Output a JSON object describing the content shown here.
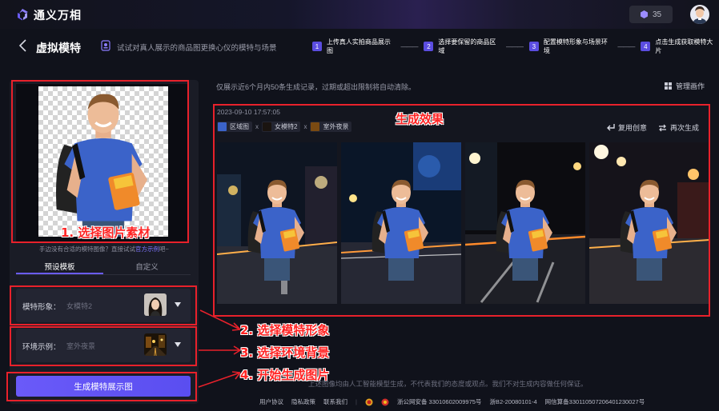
{
  "app": {
    "title": "通义万相",
    "points": "35"
  },
  "header": {
    "title": "虚拟模特",
    "subtitle": "试试对真人展示的商品图更换心仪的模特与场景",
    "steps": [
      {
        "num": "1",
        "label": "上传真人实拍商品展示图"
      },
      {
        "num": "2",
        "label": "选择要保留的商品区域"
      },
      {
        "num": "3",
        "label": "配置模特形象与场景环境"
      },
      {
        "num": "4",
        "label": "点击生成获取模特大片"
      }
    ],
    "step_separator": "———"
  },
  "left": {
    "hint_prefix": "手边没有合适的模特图像？直接试试",
    "hint_link": "官方示例",
    "hint_suffix": "吧~",
    "tabs": [
      "预设模板",
      "自定义"
    ],
    "model": {
      "label": "模特形象：",
      "value": "女模特2"
    },
    "scene": {
      "label": "环境示例：",
      "value": "室外夜景"
    },
    "generate_button": "生成模特展示图"
  },
  "main": {
    "notice": "仅展示近6个月内50条生成记录，过期或超出限制将自动清除。",
    "manage_label": "管理画作",
    "record": {
      "timestamp": "2023-09-10 17:57:05",
      "tags": [
        "区域图",
        "女模特2",
        "室外夜景"
      ],
      "tag_separator": "x",
      "reuse_label": "复用创意",
      "regenerate_label": "再次生成"
    }
  },
  "annotations": {
    "title": "生成效果",
    "a1": "1. 选择图片素材",
    "a2": "2. 选择模特形象",
    "a3": "3. 选择环境背景",
    "a4": "4. 开始生成图片",
    "color": "#e8212b"
  },
  "footer": {
    "disclaimer": "上述图像均由人工智能模型生成，不代表我们的态度或观点。我们不对生成内容做任何保证。",
    "links": [
      "用户协议",
      "隐私政策",
      "联系我们"
    ],
    "icp1": "浙公网安备 33010602009975号",
    "icp2": "浙B2-20080101-4",
    "icp3": "网信算备330110507206401230027号"
  },
  "colors": {
    "accent": "#6a5cf6",
    "background": "#10121b",
    "annotation": "#e8212b"
  }
}
